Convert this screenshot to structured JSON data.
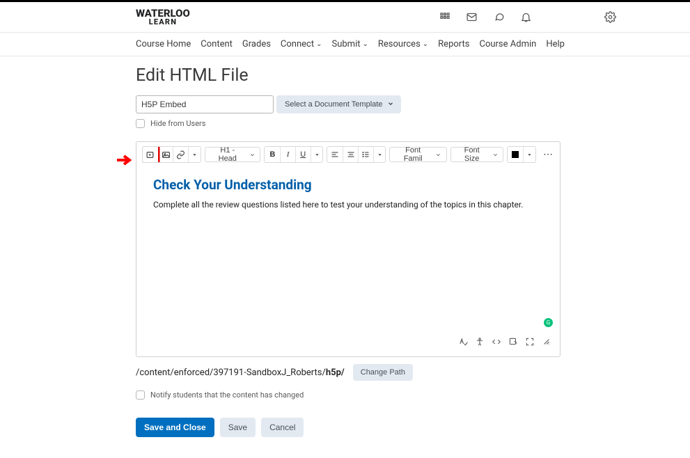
{
  "brand": {
    "line1": "WATERLOO",
    "line2": "LEARN"
  },
  "nav": {
    "items": [
      {
        "label": "Course Home",
        "hasChevron": false
      },
      {
        "label": "Content",
        "hasChevron": false
      },
      {
        "label": "Grades",
        "hasChevron": false
      },
      {
        "label": "Connect",
        "hasChevron": true
      },
      {
        "label": "Submit",
        "hasChevron": true
      },
      {
        "label": "Resources",
        "hasChevron": true
      },
      {
        "label": "Reports",
        "hasChevron": false
      },
      {
        "label": "Course Admin",
        "hasChevron": false
      },
      {
        "label": "Help",
        "hasChevron": false
      }
    ]
  },
  "page": {
    "title": "Edit HTML File",
    "file_title_value": "H5P Embed",
    "template_button_label": "Select a Document Template",
    "hide_checkbox_label": "Hide from Users",
    "notify_checkbox_label": "Notify students that the content has changed",
    "path_prefix": "/content/enforced/397191-SandboxJ_Roberts/",
    "path_bold": "h5p/",
    "change_path_label": "Change Path",
    "actions": {
      "save_and_close": "Save and Close",
      "save": "Save",
      "cancel": "Cancel"
    }
  },
  "toolbar": {
    "paragraph_label": "H1 - Head",
    "font_family_label": "Font Famil",
    "font_size_label": "Font Size",
    "color": "#000000"
  },
  "content": {
    "heading": "Check Your Understanding",
    "paragraph": "Complete all the review questions listed here to test your understanding of the topics in this chapter."
  }
}
